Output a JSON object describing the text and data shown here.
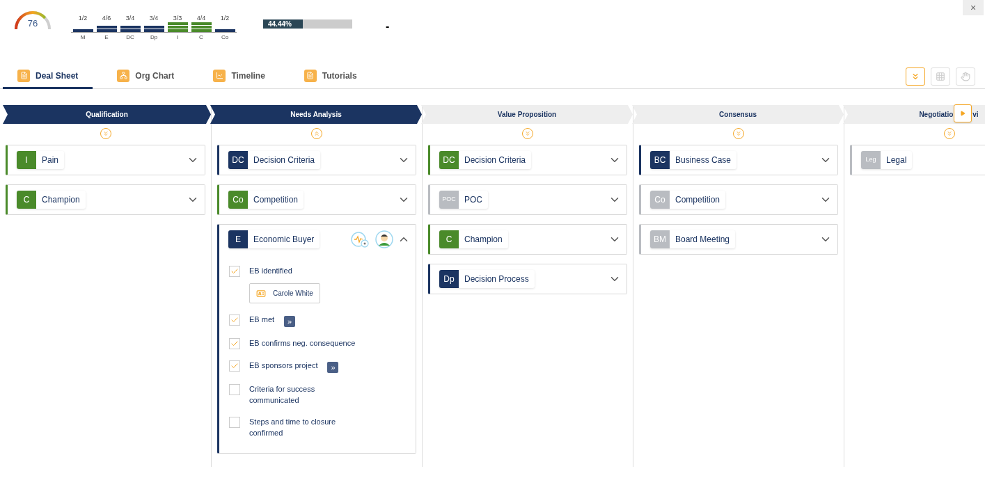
{
  "header": {
    "gauge": {
      "value": "76",
      "level": 0.76
    },
    "scores": [
      {
        "fraction": "1/2",
        "label": "M",
        "color": "#1b3461",
        "bars": [
          {
            "kind": "bar"
          }
        ]
      },
      {
        "fraction": "4/6",
        "label": "E",
        "color": "#1b3461",
        "bars": [
          {
            "kind": "bar"
          },
          {
            "kind": "bar"
          }
        ]
      },
      {
        "fraction": "3/4",
        "label": "DC",
        "color": "#1b3461",
        "bars": [
          {
            "kind": "bar"
          },
          {
            "kind": "bar"
          }
        ]
      },
      {
        "fraction": "3/4",
        "label": "Dp",
        "color": "#1b3461",
        "bars": [
          {
            "kind": "bar"
          },
          {
            "kind": "bar"
          }
        ]
      },
      {
        "fraction": "3/3",
        "label": "I",
        "color": "#4a8a2a",
        "bars": [
          {
            "kind": "bar"
          },
          {
            "kind": "bar"
          },
          {
            "kind": "bar"
          }
        ]
      },
      {
        "fraction": "4/4",
        "label": "C",
        "color": "#4a8a2a",
        "bars": [
          {
            "kind": "bar"
          },
          {
            "kind": "bar"
          },
          {
            "kind": "bar"
          }
        ]
      },
      {
        "fraction": "1/2",
        "label": "Co",
        "color": "#1b3461",
        "bars": [
          {
            "kind": "bar"
          }
        ]
      }
    ],
    "progress": {
      "text": "44.44%",
      "level": 0.4444
    },
    "dash": "-",
    "close": "×"
  },
  "tabs": [
    {
      "label": "Deal Sheet",
      "selected": true
    },
    {
      "label": "Org Chart",
      "selected": false
    },
    {
      "label": "Timeline",
      "selected": false
    },
    {
      "label": "Tutorials",
      "selected": false
    }
  ],
  "stages": [
    {
      "name": "Qualification",
      "completed": true,
      "cards": [
        {
          "badge": "I",
          "title": "Pain",
          "color": "#4a8a2a",
          "expanded": false
        },
        {
          "badge": "C",
          "title": "Champion",
          "color": "#4a8a2a",
          "expanded": false
        }
      ]
    },
    {
      "name": "Needs Analysis",
      "completed": true,
      "cards": [
        {
          "badge": "DC",
          "title": "Decision Criteria",
          "color": "#1b3461",
          "expanded": false
        },
        {
          "badge": "Co",
          "title": "Competition",
          "color": "#4a8a2a",
          "expanded": false
        },
        {
          "badge": "E",
          "title": "Economic Buyer",
          "color": "#1b3461",
          "expanded": true,
          "items": [
            {
              "label": "EB identified",
              "checked": true,
              "contact": "Carole White"
            },
            {
              "label": "EB met",
              "checked": true,
              "forward": "»"
            },
            {
              "label": "EB confirms neg. consequence",
              "checked": true
            },
            {
              "label": "EB sponsors project",
              "checked": true,
              "forward": "»"
            },
            {
              "label": "Criteria for success communicated",
              "checked": false
            },
            {
              "label": "Steps and time to closure confirmed",
              "checked": false
            }
          ]
        }
      ]
    },
    {
      "name": "Value Proposition",
      "completed": false,
      "cards": [
        {
          "badge": "DC",
          "title": "Decision Criteria",
          "color": "#4a8a2a",
          "expanded": false
        },
        {
          "badge": "POC",
          "title": "POC",
          "color": "#b9bcc1",
          "expanded": false
        },
        {
          "badge": "C",
          "title": "Champion",
          "color": "#4a8a2a",
          "expanded": false
        },
        {
          "badge": "Dp",
          "title": "Decision Process",
          "color": "#1b3461",
          "expanded": false
        }
      ]
    },
    {
      "name": "Consensus",
      "completed": false,
      "cards": [
        {
          "badge": "BC",
          "title": "Business Case",
          "color": "#1b3461",
          "expanded": false
        },
        {
          "badge": "Co",
          "title": "Competition",
          "color": "#b9bcc1",
          "expanded": false
        },
        {
          "badge": "BM",
          "title": "Board Meeting",
          "color": "#b9bcc1",
          "expanded": false
        }
      ]
    },
    {
      "name": "Negotiatio",
      "tail": "vi",
      "completed": false,
      "cards": [
        {
          "badge": "Leg",
          "title": "Legal",
          "color": "#b9bcc1",
          "expanded": false
        }
      ]
    }
  ]
}
